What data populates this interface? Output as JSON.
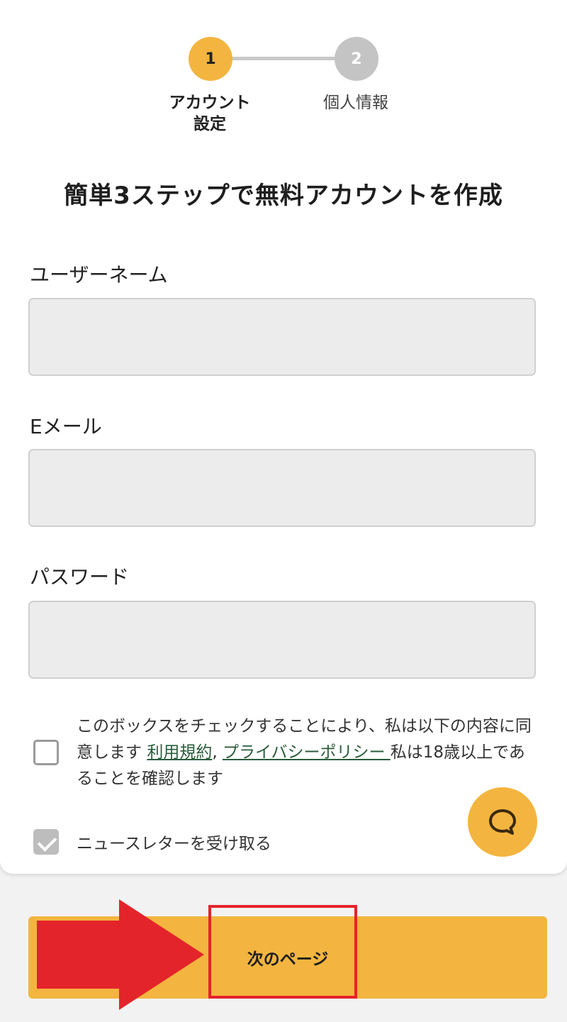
{
  "stepper": {
    "steps": [
      {
        "number": "1",
        "label": "アカウント\n設定",
        "status": "active"
      },
      {
        "number": "2",
        "label": "個人情報",
        "status": "inactive"
      }
    ]
  },
  "title": "簡単3ステップで無料アカウントを作成",
  "form": {
    "username": {
      "label": "ユーザーネーム",
      "value": ""
    },
    "email": {
      "label": "Eメール",
      "value": ""
    },
    "password": {
      "label": "パスワード",
      "value": ""
    }
  },
  "consent": {
    "text_before": "このボックスをチェックすることにより、私は以下の内容に同意します ",
    "terms_link": "利用規約",
    "separator": ", ",
    "privacy_link": "プライバシーポリシー ",
    "text_after": "私は18歳以上であることを確認します",
    "checked": false
  },
  "newsletter": {
    "label": "ニュースレターを受け取る",
    "checked": true
  },
  "chat": {
    "icon": "chat-bubble-icon"
  },
  "next_button": {
    "label": "次のページ"
  },
  "colors": {
    "accent": "#f3b53f",
    "inactive_step": "#c4c4c4",
    "link": "#2a5c3a",
    "annotation": "#e4242b"
  }
}
